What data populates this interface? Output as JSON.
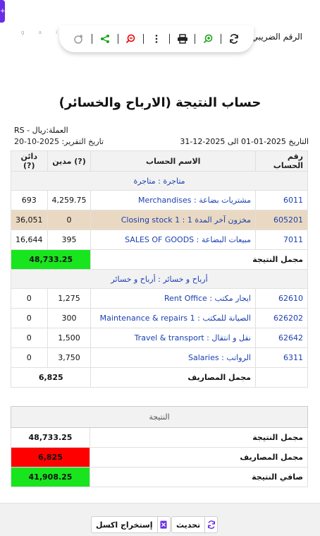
{
  "toolbar_hint": "",
  "tax_label": "الرقم الضريبي",
  "faint_text": "g a i",
  "title": "حساب النتيجة (الارباح والخسائر)",
  "currency": "العملة:ريال - RS",
  "report_date": "تاريخ التقرير: 2025-10-20",
  "period": "التاريخ 2025-01-01 الى 2025-12-31",
  "table": {
    "headers": {
      "num": "رقم الحساب",
      "name": "الاسم الحساب",
      "debit": "مدين (?)",
      "credit": "دائن (?)"
    },
    "group1": "متاجرة : متاجرة",
    "rows1": [
      {
        "num": "6011",
        "name": "مشتريات بضاعة : Merchandises",
        "debit": "4,259.75",
        "credit": "693"
      },
      {
        "num": "605201",
        "name": "مخزون آخر المدة 1 : Closing stock 1",
        "debit": "0",
        "credit": "36,051"
      },
      {
        "num": "7011",
        "name": "مبيعات البضاعة : SALES OF GOODS",
        "debit": "395",
        "credit": "16,644"
      }
    ],
    "total1_label": "مجمل النتيجة",
    "total1_value": "48,733.25",
    "group2": "أرباح و خسائر : أرباح و خسائر",
    "rows2": [
      {
        "num": "62610",
        "name": "ايجار مكتب : Rent Office",
        "debit": "1,275",
        "credit": "0"
      },
      {
        "num": "626202",
        "name": "الصيانة للمكتب : Maintenance & repairs 1",
        "debit": "300",
        "credit": "0"
      },
      {
        "num": "62642",
        "name": "نقل و انتقال : Travel & transport",
        "debit": "1,500",
        "credit": "0"
      },
      {
        "num": "6311",
        "name": "الرواتب : Salaries",
        "debit": "3,750",
        "credit": "0"
      }
    ],
    "total2_label": "مجمل المصاريف",
    "total2_value": "6,825"
  },
  "result": {
    "header": "النتيجة",
    "rows": [
      {
        "label": "مجمل النتيجة",
        "value": "48,733.25",
        "style": "plain"
      },
      {
        "label": "مجمل المصاريف",
        "value": "6,825",
        "style": "red"
      },
      {
        "label": "صافي النتيجة",
        "value": "41,908.25",
        "style": "green"
      }
    ]
  },
  "footer": {
    "export_label": "إستخراج اكسل",
    "refresh_label": "تحديث"
  },
  "colors": {
    "accent": "#6a2ce8",
    "link": "#1a3fb2",
    "positive": "#19e51e",
    "negative": "#ff0000",
    "stock_row": "#ead9c2"
  },
  "icons": [
    "plus-icon",
    "refresh-icon",
    "zoom-in-icon",
    "print-icon",
    "more-vertical-icon",
    "zoom-out-icon",
    "share-icon",
    "add-user-icon",
    "excel-icon"
  ]
}
